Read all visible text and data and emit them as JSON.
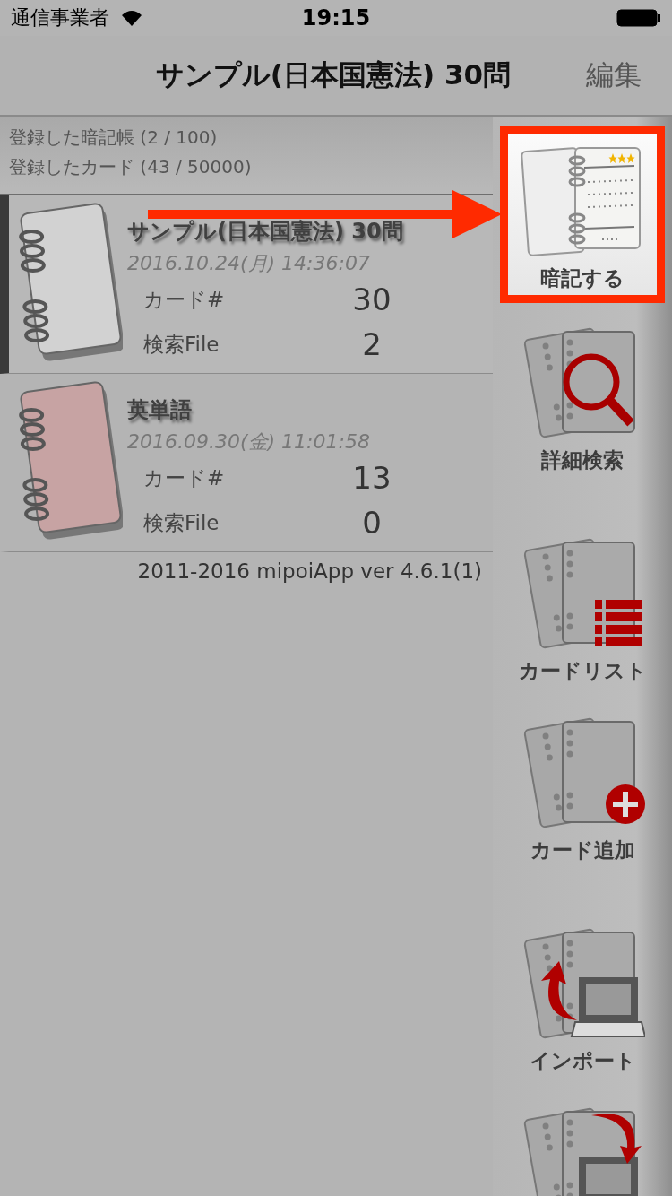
{
  "status_bar": {
    "carrier": "通信事業者",
    "time": "19:15"
  },
  "nav_bar": {
    "title": "サンプル(日本国憲法) 30問",
    "edit": "編集"
  },
  "summary": [
    "登録した暗記帳 (2 / 100)",
    "登録したカード (43 / 50000)"
  ],
  "notebooks": [
    {
      "title": "サンプル(日本国憲法) 30問",
      "date": "2016.10.24(月) 14:36:07",
      "color": "#d2d2d2",
      "selected": true,
      "stats": [
        {
          "label": "カード#",
          "value": "30"
        },
        {
          "label": "検索File",
          "value": "2"
        }
      ]
    },
    {
      "title": "英単語",
      "date": "2016.09.30(金) 11:01:58",
      "color": "#c7a3a3",
      "selected": false,
      "stats": [
        {
          "label": "カード#",
          "value": "13"
        },
        {
          "label": "検索File",
          "value": "0"
        }
      ]
    }
  ],
  "footer": "2011-2016 mipoiApp ver 4.6.1(1)",
  "callout_arrow": true,
  "toolbar_groups": [
    [
      {
        "kind": "study",
        "label": "暗記する",
        "highlighted": true
      },
      {
        "kind": "search",
        "label": "詳細検索",
        "highlighted": false
      }
    ],
    [
      {
        "kind": "list",
        "label": "カードリスト",
        "highlighted": false
      },
      {
        "kind": "add",
        "label": "カード追加",
        "highlighted": false
      }
    ],
    [
      {
        "kind": "import",
        "label": "インポート",
        "highlighted": false
      },
      {
        "kind": "export",
        "highlighted": false
      }
    ]
  ]
}
